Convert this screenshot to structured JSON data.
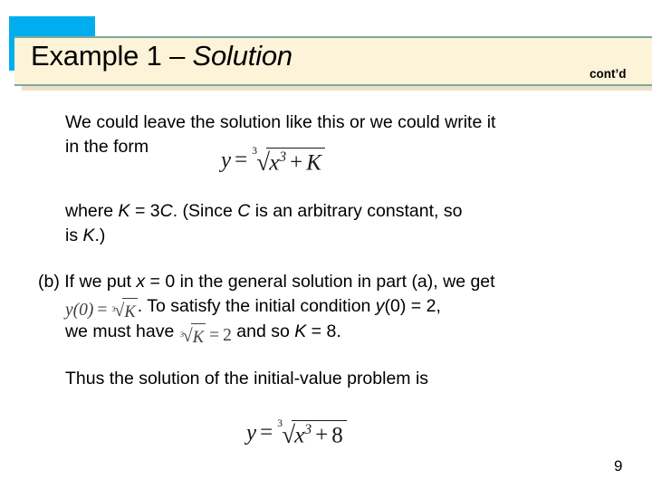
{
  "slide": {
    "header": {
      "title_main": "Example 1 – ",
      "title_italic": "Solution",
      "continued_label": "cont’d",
      "accent_color": "#00AEEF",
      "banner_color": "#fdf3d8",
      "banner_rule_color": "#7fa8a0"
    },
    "body": {
      "intro_line1": "We could leave the solution like this or we could write it",
      "intro_line2": "in the form",
      "equation_1": {
        "lhs_var": "y",
        "relation": "=",
        "root_degree": "3",
        "radicand_base": "x",
        "radicand_exponent": "3",
        "radicand_operator": "+",
        "radicand_constant": "K",
        "plain_text": "y = cube root of (x^3 + K)"
      },
      "where_line1_pre": "where ",
      "where_line1_k": "K",
      "where_line1_mid": " = 3",
      "where_line1_c": "C",
      "where_line1_post": ". (Since ",
      "where_line1_c2": "C",
      "where_line1_end": " is an arbitrary constant, so",
      "where_line2_pre": "is ",
      "where_line2_k": "K",
      "where_line2_post": ".)",
      "partb_label": "(b) If we put ",
      "partb_x": "x",
      "partb_rest": " = 0 in the general solution in part (a), we get",
      "inline_equation_b": {
        "lhs": "y(0)",
        "relation": "=",
        "root_degree": "3",
        "radicand": "K",
        "plain_text": "y(0) = cube root of K"
      },
      "b_line2_after_eq": ". To satisfy the initial condition ",
      "b_line2_y": "y",
      "b_line2_cond": "(0) = 2,",
      "b_line3_pre": "we must have ",
      "inline_equation_c": {
        "root_degree": "3",
        "radicand": "K",
        "relation": "=",
        "rhs": "2",
        "plain_text": "cube root of K = 2"
      },
      "b_line3_mid": " and so ",
      "b_line3_k": "K",
      "b_line3_post": " = 8.",
      "thus_line": "Thus the solution of the initial-value problem is",
      "equation_2": {
        "lhs_var": "y",
        "relation": "=",
        "root_degree": "3",
        "radicand_base": "x",
        "radicand_exponent": "3",
        "radicand_operator": "+",
        "radicand_constant": "8",
        "plain_text": "y = cube root of (x^3 + 8)"
      }
    },
    "footer": {
      "page_number": "9"
    }
  }
}
